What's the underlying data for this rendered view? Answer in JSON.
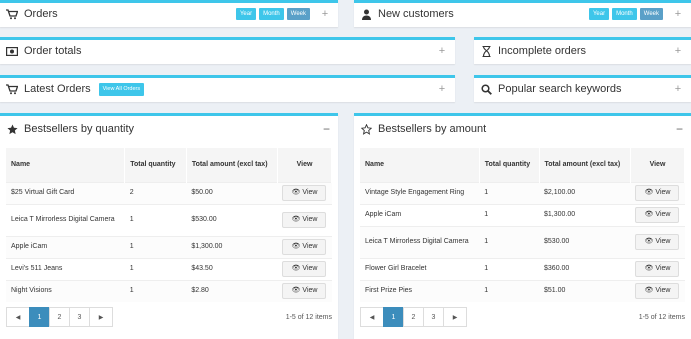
{
  "colors": {
    "accent": "#3ec6ea",
    "active_page": "#3c8dbc",
    "background": "#ecf0f5"
  },
  "orders": {
    "title": "Orders",
    "icon": "cart-icon",
    "periods": [
      "Year",
      "Month",
      "Week"
    ],
    "active_period": "Week"
  },
  "new_customers": {
    "title": "New customers",
    "icon": "user-icon",
    "periods": [
      "Year",
      "Month",
      "Week"
    ],
    "active_period": "Week"
  },
  "order_totals": {
    "title": "Order totals",
    "icon": "money-icon"
  },
  "incomplete_orders": {
    "title": "Incomplete orders",
    "icon": "hourglass-icon"
  },
  "latest_orders": {
    "title": "Latest Orders",
    "icon": "cart-icon",
    "view_all_label": "View All Orders"
  },
  "popular_keywords": {
    "title": "Popular search keywords",
    "icon": "search-icon"
  },
  "bestsellers_quantity": {
    "title": "Bestsellers by quantity",
    "icon": "star-filled-icon",
    "columns": [
      "Name",
      "Total quantity",
      "Total amount (excl tax)",
      "View"
    ],
    "rows": [
      {
        "name": "$25 Virtual Gift Card",
        "quantity": "2",
        "amount": "$50.00",
        "view": "View"
      },
      {
        "name": "Leica T Mirrorless Digital Camera",
        "quantity": "1",
        "amount": "$530.00",
        "view": "View"
      },
      {
        "name": "Apple iCam",
        "quantity": "1",
        "amount": "$1,300.00",
        "view": "View"
      },
      {
        "name": "Levi's 511 Jeans",
        "quantity": "1",
        "amount": "$43.50",
        "view": "View"
      },
      {
        "name": "Night Visions",
        "quantity": "1",
        "amount": "$2.80",
        "view": "View"
      }
    ],
    "pages": [
      "1",
      "2",
      "3"
    ],
    "active_page": "1",
    "count_text": "1-5 of 12 items"
  },
  "bestsellers_amount": {
    "title": "Bestsellers by amount",
    "icon": "star-outline-icon",
    "columns": [
      "Name",
      "Total quantity",
      "Total amount (excl tax)",
      "View"
    ],
    "rows": [
      {
        "name": "Vintage Style Engagement Ring",
        "quantity": "1",
        "amount": "$2,100.00",
        "view": "View"
      },
      {
        "name": "Apple iCam",
        "quantity": "1",
        "amount": "$1,300.00",
        "view": "View"
      },
      {
        "name": "Leica T Mirrorless Digital Camera",
        "quantity": "1",
        "amount": "$530.00",
        "view": "View"
      },
      {
        "name": "Flower Girl Bracelet",
        "quantity": "1",
        "amount": "$360.00",
        "view": "View"
      },
      {
        "name": "First Prize Pies",
        "quantity": "1",
        "amount": "$51.00",
        "view": "View"
      }
    ],
    "pages": [
      "1",
      "2",
      "3"
    ],
    "active_page": "1",
    "count_text": "1-5 of 12 items"
  }
}
